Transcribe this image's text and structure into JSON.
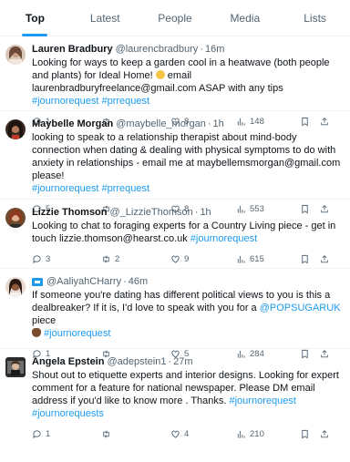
{
  "tabs": [
    {
      "label": "Top",
      "active": true
    },
    {
      "label": "Latest",
      "active": false
    },
    {
      "label": "People",
      "active": false
    },
    {
      "label": "Media",
      "active": false
    },
    {
      "label": "Lists",
      "active": false
    }
  ],
  "colors": {
    "accent": "#1d9bf0",
    "text": "#0f1419",
    "muted": "#536471",
    "divider": "#eff3f4"
  },
  "tweets": [
    {
      "name": "Lauren Bradbury",
      "handle": "@laurencbradbury",
      "time": "16m",
      "text_1": "Looking for ways to keep a garden cool in a heatwave (both people and plants) for Ideal Home! ",
      "text_2": " email laurenbradburyfreelance@gmail.com ASAP with any tips ",
      "tag_1": "#journorequest",
      "tag_2": "#prrequest",
      "replies": "1",
      "retweets": "",
      "likes": "8",
      "views": "148"
    },
    {
      "name": "Maybelle Morgan",
      "handle": "@maybelle_morgan",
      "time": "1h",
      "text_1": "looking to speak to a relationship therapist about mind-body connection when dating & dealing with physical symptoms to do with anxiety in relationships - email me at maybellemsmorgan@gmail.com please!",
      "tag_1": "#journorequest",
      "tag_2": "#prrequest",
      "replies": "5",
      "retweets": "",
      "likes": "8",
      "views": "553"
    },
    {
      "name": "Lizzie Thomson",
      "handle": "@_LizzieThomson",
      "time": "1h",
      "text_1": "Looking to chat to foraging experts for a Country Living piece - get in touch lizzie.thomson@hearst.co.uk ",
      "tag_1": "#journorequest",
      "replies": "3",
      "retweets": "2",
      "likes": "9",
      "views": "615"
    },
    {
      "handle": "@AaliyahCHarry",
      "time": "46m",
      "text_1": "If someone you're dating has different political views to you is this a dealbreaker? If it is, I'd love to speak with you for a ",
      "mention": "@POPSUGARUK",
      "text_2": " piece",
      "tag_1": "#journorequest",
      "replies": "1",
      "retweets": "",
      "likes": "5",
      "views": "284"
    },
    {
      "name": "Angela Epstein",
      "handle": "@adepstein1",
      "time": "27m",
      "text_1": "Shout out to etiquette experts and interior designs. Looking for expert comment for a feature for national newspaper. Please DM email address if you'd like to know more . Thanks. ",
      "tag_1": "#journorequest",
      "tag_2": "#journorequests",
      "replies": "1",
      "retweets": "",
      "likes": "4",
      "views": "210"
    }
  ],
  "icons": {
    "reply": "reply-icon",
    "retweet": "retweet-icon",
    "like": "heart-icon",
    "views": "views-icon",
    "bookmark": "bookmark-icon",
    "share": "share-icon"
  }
}
